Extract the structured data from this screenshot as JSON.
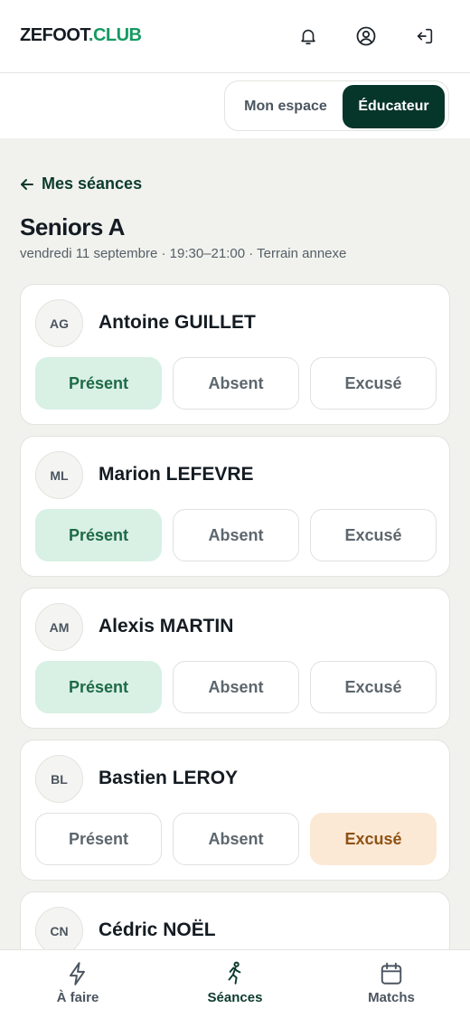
{
  "app": {
    "brand_main": "ZEFOOT",
    "brand_accent": ".CLUB"
  },
  "header_icons": [
    "bell-icon",
    "user-circle-icon",
    "logout-icon"
  ],
  "role_switch": {
    "options": [
      "Mon espace",
      "Éducateur"
    ],
    "selected": "Éducateur"
  },
  "session": {
    "back_label": "Mes séances",
    "title": "Seniors A",
    "subtitle": "vendredi 11 septembre · 19:30–21:00 · Terrain annexe"
  },
  "status_labels": {
    "present": "Présent",
    "absent": "Absent",
    "excuse": "Excusé"
  },
  "players": [
    {
      "initials": "AG",
      "name": "Antoine GUILLET",
      "status": "present"
    },
    {
      "initials": "ML",
      "name": "Marion LEFEVRE",
      "status": "present"
    },
    {
      "initials": "AM",
      "name": "Alexis MARTIN",
      "status": "present"
    },
    {
      "initials": "BL",
      "name": "Bastien LEROY",
      "status": "excuse"
    },
    {
      "initials": "CN",
      "name": "Cédric NOËL",
      "status": ""
    }
  ],
  "bottom_nav": [
    {
      "label": "À faire",
      "icon": "lightning-icon",
      "active": false
    },
    {
      "label": "Séances",
      "icon": "runner-icon",
      "active": true
    },
    {
      "label": "Matchs",
      "icon": "calendar-icon",
      "active": false
    }
  ],
  "colors": {
    "brand_accent": "#169a62",
    "dark_green": "#06352a",
    "present_bg": "#d9f0e5",
    "excuse_bg": "#fbe9d6"
  }
}
